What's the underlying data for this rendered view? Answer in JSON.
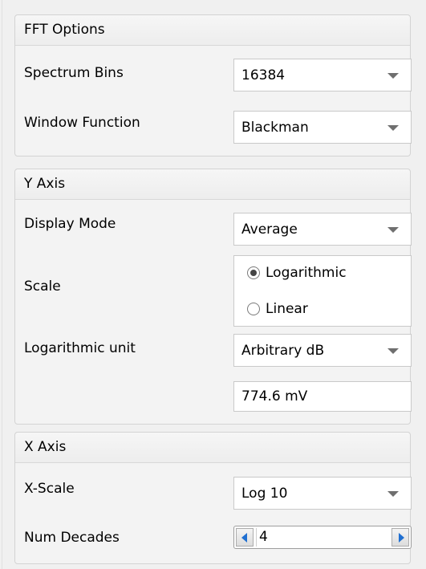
{
  "fft": {
    "title": "FFT Options",
    "spectrum_bins": {
      "label": "Spectrum Bins",
      "value": "16384"
    },
    "window_function": {
      "label": "Window Function",
      "value": "Blackman"
    }
  },
  "y_axis": {
    "title": "Y Axis",
    "display_mode": {
      "label": "Display Mode",
      "value": "Average"
    },
    "scale": {
      "label": "Scale",
      "options": [
        "Logarithmic",
        "Linear"
      ],
      "selected": "Logarithmic"
    },
    "log_unit": {
      "label": "Logarithmic unit",
      "value": "Arbitrary dB"
    },
    "reference": {
      "value": "774.6 mV"
    }
  },
  "x_axis": {
    "title": "X Axis",
    "x_scale": {
      "label": "X-Scale",
      "value": "Log 10"
    },
    "num_decades": {
      "label": "Num Decades",
      "value": "4"
    }
  },
  "icons": [
    "dropdown-arrow-icon",
    "radio-selected-icon",
    "radio-unselected-icon",
    "left-arrow-icon",
    "right-arrow-icon"
  ],
  "colors": {
    "spin_arrow": "#1f6fd1",
    "panel_bg": "#f3f3f3",
    "header_bg": "#efefef"
  }
}
